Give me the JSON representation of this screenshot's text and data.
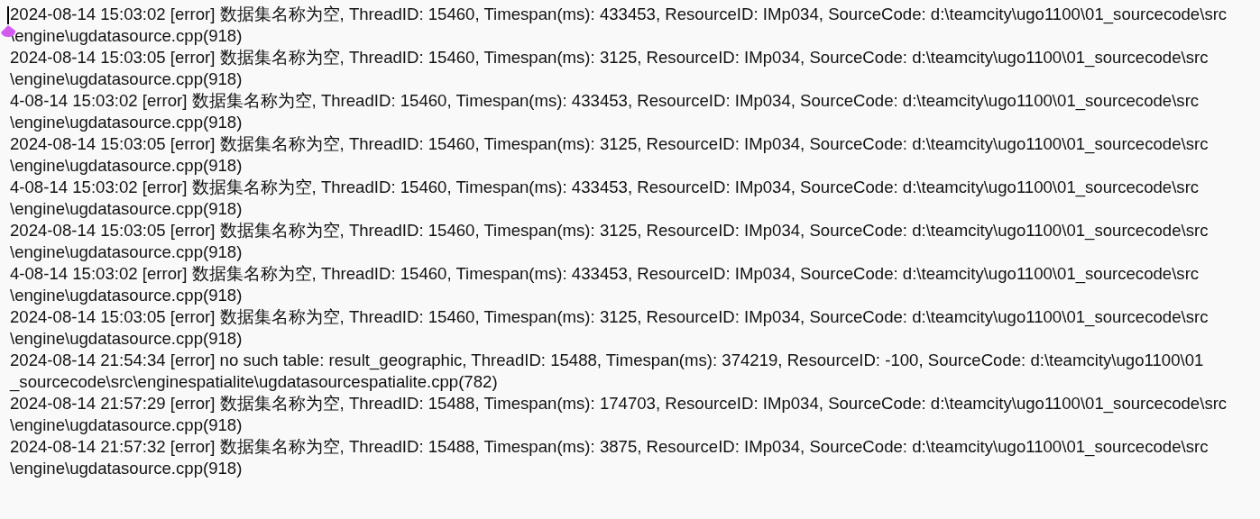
{
  "editor": {
    "lines": [
      "2024-08-14 15:03:02 [error] 数据集名称为空, ThreadID: 15460, Timespan(ms): 433453, ResourceID: IMp034, SourceCode: d:\\teamcity\\ugo1100\\01_sourcecode\\src",
      "\\engine\\ugdatasource.cpp(918)",
      "2024-08-14 15:03:05 [error] 数据集名称为空, ThreadID: 15460, Timespan(ms): 3125, ResourceID: IMp034, SourceCode: d:\\teamcity\\ugo1100\\01_sourcecode\\src",
      "\\engine\\ugdatasource.cpp(918)",
      "4-08-14 15:03:02 [error] 数据集名称为空, ThreadID: 15460, Timespan(ms): 433453, ResourceID: IMp034, SourceCode: d:\\teamcity\\ugo1100\\01_sourcecode\\src",
      "\\engine\\ugdatasource.cpp(918)",
      "2024-08-14 15:03:05 [error] 数据集名称为空, ThreadID: 15460, Timespan(ms): 3125, ResourceID: IMp034, SourceCode: d:\\teamcity\\ugo1100\\01_sourcecode\\src",
      "\\engine\\ugdatasource.cpp(918)",
      "4-08-14 15:03:02 [error] 数据集名称为空, ThreadID: 15460, Timespan(ms): 433453, ResourceID: IMp034, SourceCode: d:\\teamcity\\ugo1100\\01_sourcecode\\src",
      "\\engine\\ugdatasource.cpp(918)",
      "2024-08-14 15:03:05 [error] 数据集名称为空, ThreadID: 15460, Timespan(ms): 3125, ResourceID: IMp034, SourceCode: d:\\teamcity\\ugo1100\\01_sourcecode\\src",
      "\\engine\\ugdatasource.cpp(918)",
      "4-08-14 15:03:02 [error] 数据集名称为空, ThreadID: 15460, Timespan(ms): 433453, ResourceID: IMp034, SourceCode: d:\\teamcity\\ugo1100\\01_sourcecode\\src",
      "\\engine\\ugdatasource.cpp(918)",
      "2024-08-14 15:03:05 [error] 数据集名称为空, ThreadID: 15460, Timespan(ms): 3125, ResourceID: IMp034, SourceCode: d:\\teamcity\\ugo1100\\01_sourcecode\\src",
      "\\engine\\ugdatasource.cpp(918)",
      "2024-08-14 21:54:34 [error] no such table: result_geographic, ThreadID: 15488, Timespan(ms): 374219, ResourceID: -100, SourceCode: d:\\teamcity\\ugo1100\\01",
      "_sourcecode\\src\\enginespatialite\\ugdatasourcespatialite.cpp(782)",
      "2024-08-14 21:57:29 [error] 数据集名称为空, ThreadID: 15488, Timespan(ms): 174703, ResourceID: IMp034, SourceCode: d:\\teamcity\\ugo1100\\01_sourcecode\\src",
      "\\engine\\ugdatasource.cpp(918)",
      "2024-08-14 21:57:32 [error] 数据集名称为空, ThreadID: 15488, Timespan(ms): 3875, ResourceID: IMp034, SourceCode: d:\\teamcity\\ugo1100\\01_sourcecode\\src",
      "\\engine\\ugdatasource.cpp(918)"
    ]
  }
}
